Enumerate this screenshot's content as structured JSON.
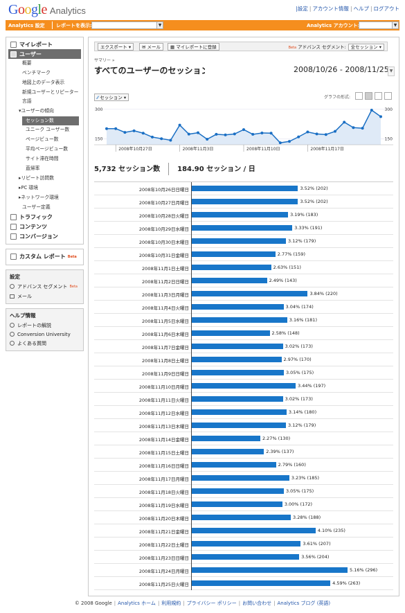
{
  "header": {
    "logo_word": "Google",
    "logo_product": "Analytics",
    "links": [
      "設定",
      "アカウント情報",
      "ヘルプ",
      "ログアウト"
    ]
  },
  "orange_bar": {
    "settings_label": "Analytics 設定",
    "report_label": "レポートを表示:",
    "account_label": "Analytics アカウント:"
  },
  "sidebar": {
    "top_items": [
      {
        "label": "マイレポート",
        "icon": "dashboard-icon"
      },
      {
        "label": "ユーザー",
        "icon": "visitors-icon",
        "active": true
      }
    ],
    "user_items": [
      "概要",
      "ベンチマーク",
      "地図上のデータ表示",
      "新規ユーザーとリピーター",
      "言語"
    ],
    "trend_header": "ユーザーの傾向",
    "trend_items": [
      "セッション数",
      "ユニーク ユーザー数",
      "ページビュー数",
      "平均ページビュー数",
      "サイト滞在時間",
      "直帰率"
    ],
    "more_items": [
      "リピート訪問数",
      "PC 環境",
      "ネットワーク環境",
      "ユーザー定義"
    ],
    "bottom_items": [
      {
        "label": "トラフィック",
        "icon": "traffic-icon"
      },
      {
        "label": "コンテンツ",
        "icon": "content-icon"
      },
      {
        "label": "コンバージョン",
        "icon": "goals-icon"
      }
    ],
    "custom_reports": {
      "label": "カスタム レポート",
      "beta": "Beta"
    },
    "settings_box": {
      "title": "設定",
      "items": [
        "アドバンス セグメント",
        "メール"
      ],
      "beta": "Beta"
    },
    "help_box": {
      "title": "ヘルプ情報",
      "items": [
        "レポートの解説",
        "Conversion University",
        "よくある質問"
      ]
    }
  },
  "toolbar": {
    "export": "エクスポート",
    "email": "メール",
    "add_to_dashboard": "マイレポートに登録",
    "beta": "Beta",
    "advanced_segment": "アドバンス セグメント:",
    "segment_value": "全セッション"
  },
  "page": {
    "breadcrumb": "サマリー »",
    "title": "すべてのユーザーのセッション",
    "date_range": "2008/10/26 - 2008/11/25",
    "metric_selector": "セッション",
    "graph_form_label": "グラフの形式:",
    "total_sessions": "5,732 セッション数",
    "avg_sessions": "184.90 セッション / 日"
  },
  "chart_data": {
    "type": "area",
    "y_ticks": [
      "300",
      "150"
    ],
    "x_ticks": [
      "2008年10月27日",
      "2008年11月3日",
      "2008年11月10日",
      "2008年11月17日"
    ],
    "series": [
      {
        "name": "セッション",
        "values": [
          202,
          202,
          183,
          191,
          179,
          159,
          151,
          143,
          220,
          174,
          181,
          148,
          173,
          170,
          175,
          197,
          173,
          180,
          179,
          130,
          137,
          160,
          185,
          175,
          172,
          188,
          235,
          207,
          204,
          296,
          263
        ]
      }
    ],
    "color": "#1a6fc4",
    "fill": "#dfeaf7",
    "y_max": 300
  },
  "table": {
    "rows": [
      {
        "date": "2008年10月26日日曜日",
        "pct": 3.52,
        "count": 202
      },
      {
        "date": "2008年10月27日月曜日",
        "pct": 3.52,
        "count": 202
      },
      {
        "date": "2008年10月28日火曜日",
        "pct": 3.19,
        "count": 183
      },
      {
        "date": "2008年10月29日水曜日",
        "pct": 3.33,
        "count": 191
      },
      {
        "date": "2008年10月30日木曜日",
        "pct": 3.12,
        "count": 179
      },
      {
        "date": "2008年10月31日金曜日",
        "pct": 2.77,
        "count": 159
      },
      {
        "date": "2008年11月1日土曜日",
        "pct": 2.63,
        "count": 151
      },
      {
        "date": "2008年11月2日日曜日",
        "pct": 2.49,
        "count": 143
      },
      {
        "date": "2008年11月3日月曜日",
        "pct": 3.84,
        "count": 220
      },
      {
        "date": "2008年11月4日火曜日",
        "pct": 3.04,
        "count": 174
      },
      {
        "date": "2008年11月5日水曜日",
        "pct": 3.16,
        "count": 181
      },
      {
        "date": "2008年11月6日木曜日",
        "pct": 2.58,
        "count": 148
      },
      {
        "date": "2008年11月7日金曜日",
        "pct": 3.02,
        "count": 173
      },
      {
        "date": "2008年11月8日土曜日",
        "pct": 2.97,
        "count": 170
      },
      {
        "date": "2008年11月9日日曜日",
        "pct": 3.05,
        "count": 175
      },
      {
        "date": "2008年11月10日月曜日",
        "pct": 3.44,
        "count": 197
      },
      {
        "date": "2008年11月11日火曜日",
        "pct": 3.02,
        "count": 173
      },
      {
        "date": "2008年11月12日水曜日",
        "pct": 3.14,
        "count": 180
      },
      {
        "date": "2008年11月13日木曜日",
        "pct": 3.12,
        "count": 179
      },
      {
        "date": "2008年11月14日金曜日",
        "pct": 2.27,
        "count": 130
      },
      {
        "date": "2008年11月15日土曜日",
        "pct": 2.39,
        "count": 137
      },
      {
        "date": "2008年11月16日日曜日",
        "pct": 2.79,
        "count": 160
      },
      {
        "date": "2008年11月17日月曜日",
        "pct": 3.23,
        "count": 185
      },
      {
        "date": "2008年11月18日火曜日",
        "pct": 3.05,
        "count": 175
      },
      {
        "date": "2008年11月19日水曜日",
        "pct": 3.0,
        "count": 172
      },
      {
        "date": "2008年11月20日木曜日",
        "pct": 3.28,
        "count": 188
      },
      {
        "date": "2008年11月21日金曜日",
        "pct": 4.1,
        "count": 235
      },
      {
        "date": "2008年11月22日土曜日",
        "pct": 3.61,
        "count": 207
      },
      {
        "date": "2008年11月23日日曜日",
        "pct": 3.56,
        "count": 204
      },
      {
        "date": "2008年11月24日月曜日",
        "pct": 5.16,
        "count": 296
      },
      {
        "date": "2008年11月25日火曜日",
        "pct": 4.59,
        "count": 263
      }
    ]
  },
  "footer": {
    "items": [
      "© 2008 Google",
      "Analytics ホーム",
      "利用規約",
      "プライバシー ポリシー",
      "お問い合わせ",
      "Analytics ブログ (英語)"
    ]
  }
}
